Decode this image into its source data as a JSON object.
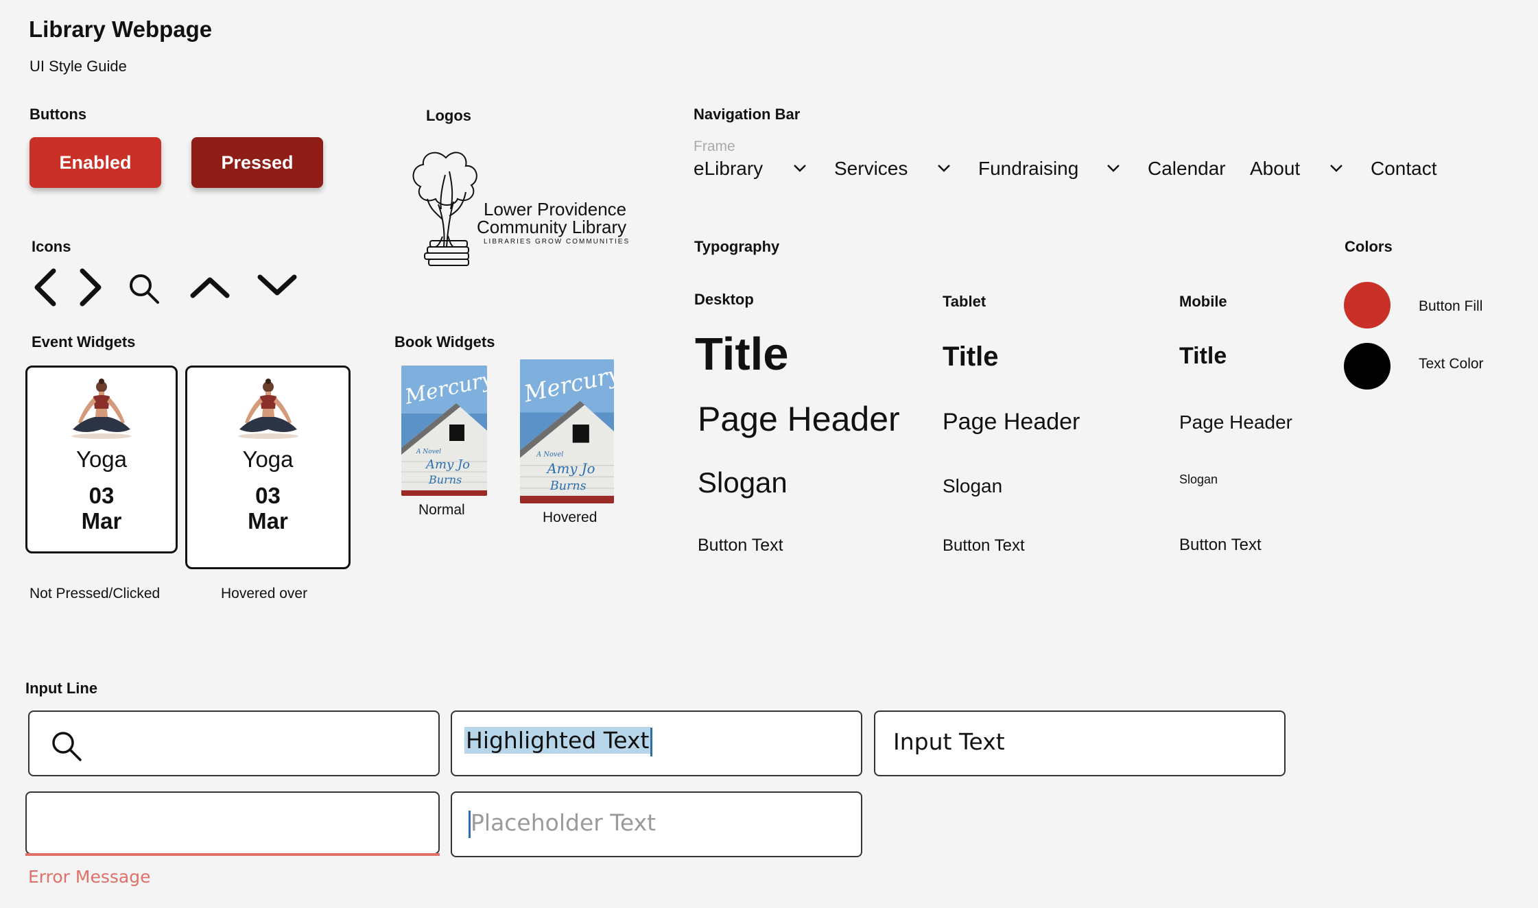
{
  "header": {
    "title": "Library Webpage",
    "subtitle": "UI Style Guide"
  },
  "buttons": {
    "heading": "Buttons",
    "enabled_label": "Enabled",
    "pressed_label": "Pressed"
  },
  "colors_brand": {
    "button_fill": "#c93027",
    "button_pressed": "#8f1d17",
    "text": "#000000"
  },
  "logos": {
    "heading": "Logos",
    "line1": "Lower Providence",
    "line2": "Community Library",
    "tagline": "LIBRARIES GROW COMMUNITIES"
  },
  "icons": {
    "heading": "Icons",
    "items": [
      "chevron-left-icon",
      "chevron-right-icon",
      "search-icon",
      "chevron-up-icon",
      "chevron-down-icon"
    ]
  },
  "nav": {
    "heading": "Navigation Bar",
    "frame_label": "Frame",
    "items": [
      {
        "label": "eLibrary",
        "dropdown": true
      },
      {
        "label": "Services",
        "dropdown": true
      },
      {
        "label": "Fundraising",
        "dropdown": true
      },
      {
        "label": "Calendar",
        "dropdown": false
      },
      {
        "label": "About",
        "dropdown": true
      },
      {
        "label": "Contact",
        "dropdown": false
      }
    ]
  },
  "typography": {
    "heading": "Typography",
    "columns": [
      {
        "name": "Desktop",
        "title": "Title",
        "page_header": "Page Header",
        "slogan": "Slogan",
        "button_text": "Button Text"
      },
      {
        "name": "Tablet",
        "title": "Title",
        "page_header": "Page Header",
        "slogan": "Slogan",
        "button_text": "Button Text"
      },
      {
        "name": "Mobile",
        "title": "Title",
        "page_header": "Page Header",
        "slogan": "Slogan",
        "button_text": "Button Text"
      }
    ]
  },
  "colors": {
    "heading": "Colors",
    "items": [
      {
        "label": "Button Fill",
        "hex": "#c93027"
      },
      {
        "label": "Text Color",
        "hex": "#000000"
      }
    ]
  },
  "event_widgets": {
    "heading": "Event Widgets",
    "cards": [
      {
        "name": "Yoga",
        "day": "03",
        "month": "Mar",
        "caption": "Not Pressed/Clicked"
      },
      {
        "name": "Yoga",
        "day": "03",
        "month": "Mar",
        "caption": "Hovered over"
      }
    ]
  },
  "book_widgets": {
    "heading": "Book Widgets",
    "book_title": "Mercury",
    "book_small": "A Novel",
    "book_author_1": "Amy Jo",
    "book_author_2": "Burns",
    "captions": [
      "Normal",
      "Hovered"
    ]
  },
  "inputs": {
    "heading": "Input Line",
    "highlighted_text": "Highlighted Text",
    "input_text": "Input Text",
    "placeholder_text": "Placeholder Text",
    "error_message": "Error Message"
  }
}
